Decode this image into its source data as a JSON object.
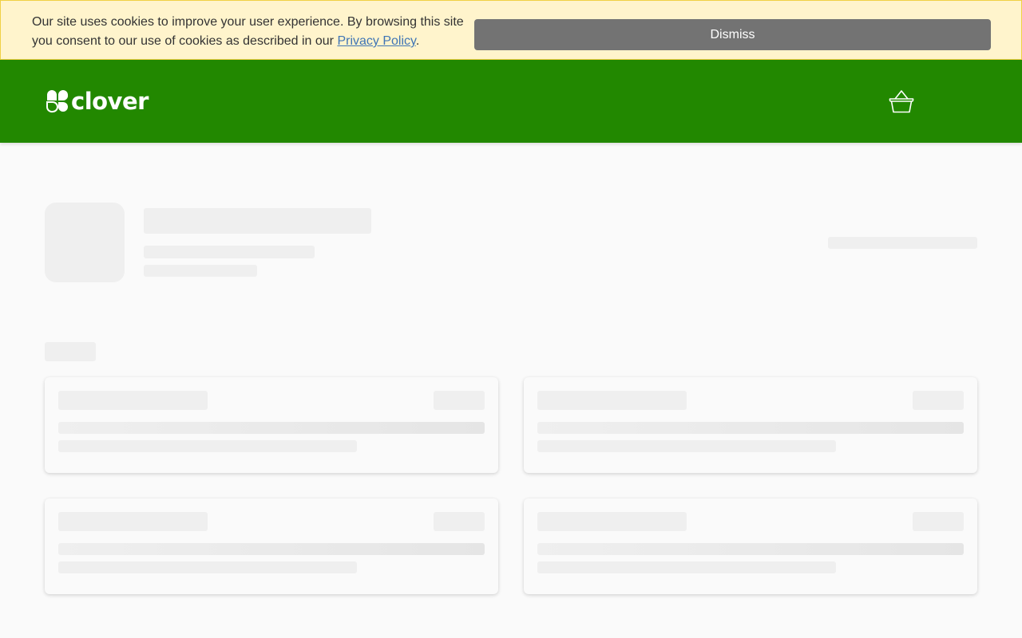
{
  "cookie_banner": {
    "text": "Our site uses cookies to improve your user experience. By browsing this site you consent to our use of cookies as described in our ",
    "link_text": "Privacy Policy",
    "suffix": ".",
    "dismiss_label": "Dismiss"
  },
  "header": {
    "brand": "clover",
    "cart_icon": "basket-icon"
  },
  "colors": {
    "header_bg": "#228800",
    "banner_bg": "#fff4cc",
    "dismiss_bg": "#737373",
    "link": "#3f75b5"
  },
  "loading_state": "skeleton placeholders"
}
